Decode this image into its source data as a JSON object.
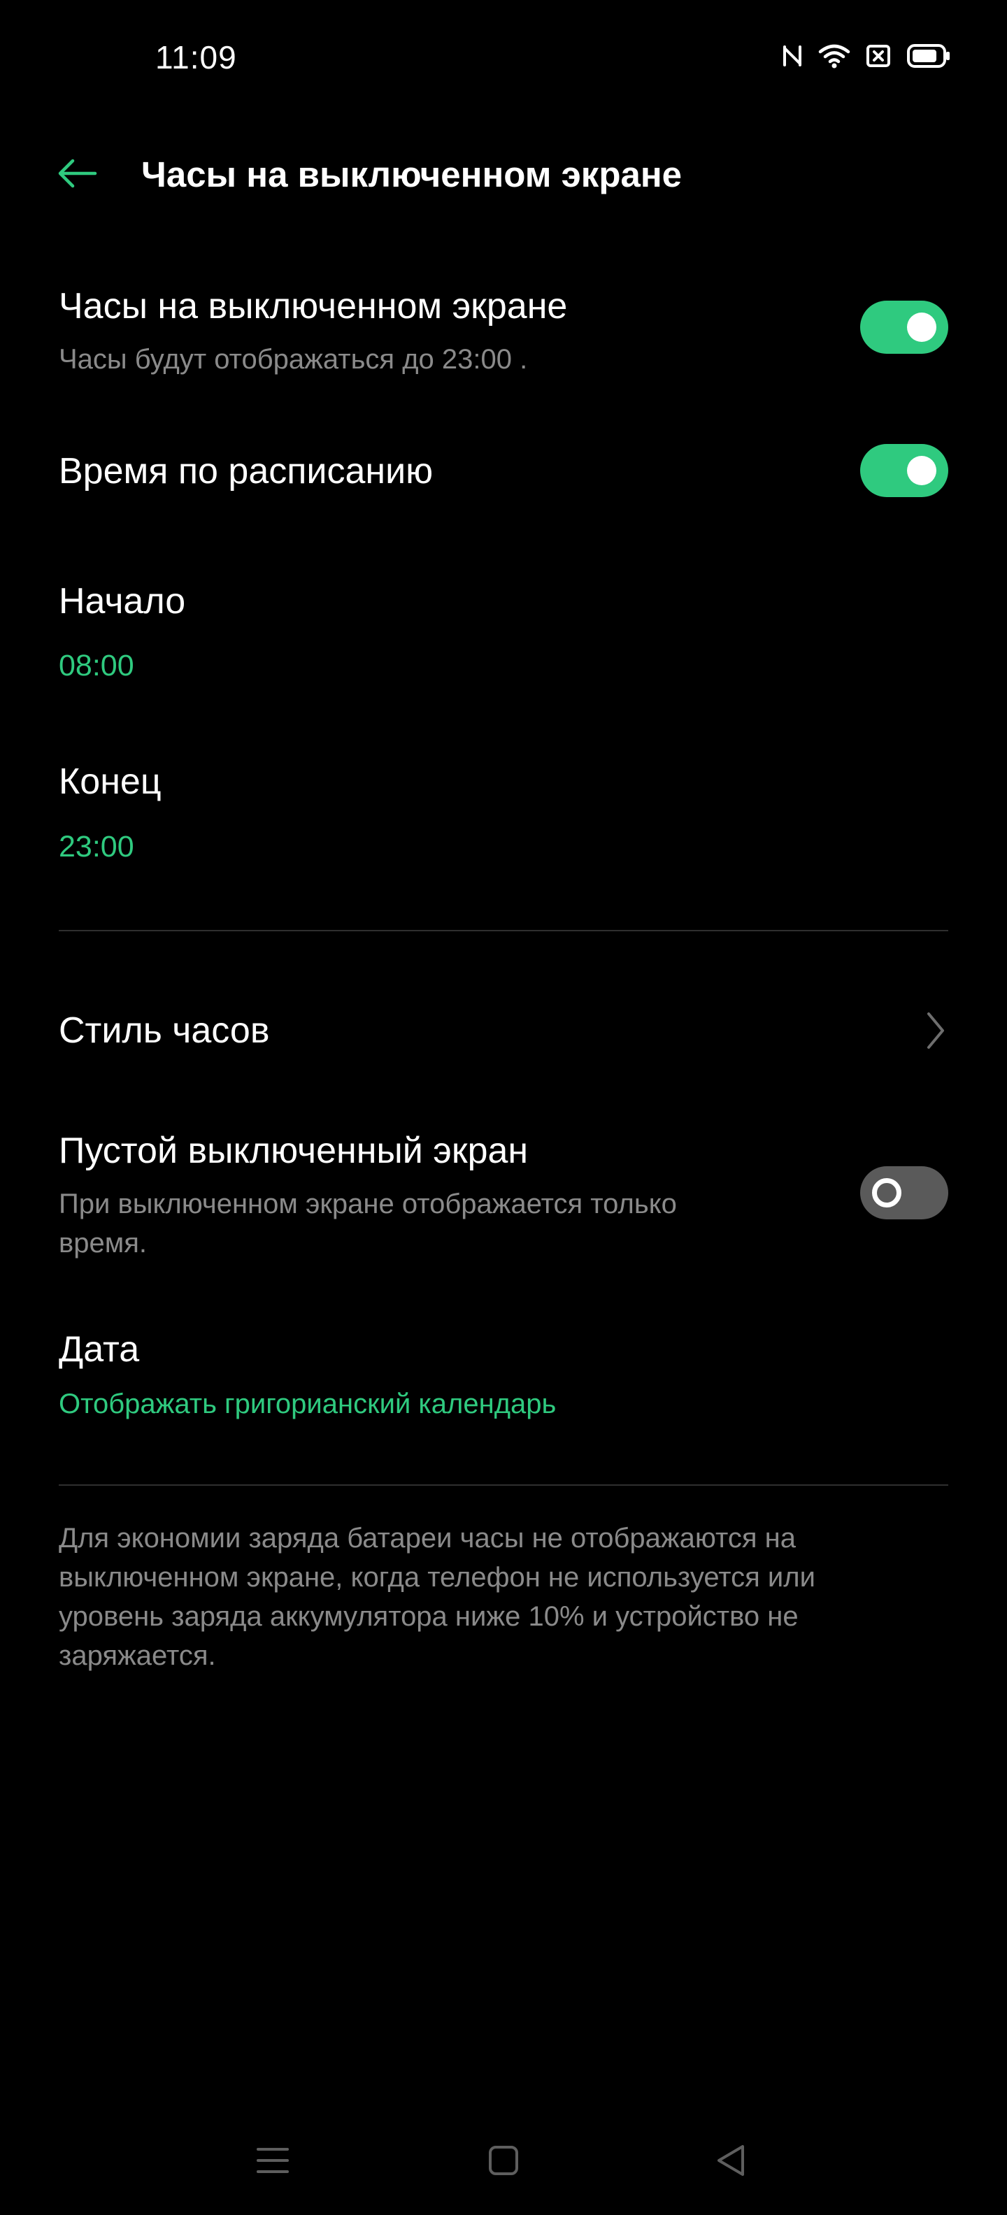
{
  "status_bar": {
    "time": "11:09",
    "icons": [
      "nfc-icon",
      "wifi-icon",
      "sim-no-signal-icon",
      "battery-icon"
    ]
  },
  "header": {
    "back_icon": "arrow-left-icon",
    "title": "Часы на выключенном экране"
  },
  "settings": {
    "aod": {
      "title": "Часы на выключенном экране",
      "subtitle": "Часы будут отображаться до  23:00 .",
      "enabled": true
    },
    "schedule": {
      "title": "Время по расписанию",
      "enabled": true
    },
    "start": {
      "title": "Начало",
      "value": "08:00"
    },
    "end": {
      "title": "Конец",
      "value": "23:00"
    },
    "clock_style": {
      "title": "Стиль часов",
      "icon": "chevron-right-icon"
    },
    "blank_screen": {
      "title": "Пустой выключенный экран",
      "subtitle_line1": "При выключенном экране отображается только",
      "subtitle_line2": "время.",
      "enabled": false
    },
    "date": {
      "title": "Дата",
      "value": "Отображать григорианский календарь"
    }
  },
  "footer_note": "Для экономии заряда батареи часы не отображаются на выключенном экране, когда телефон не используется или уровень заряда аккумулятора ниже 10% и устройство не заряжается.",
  "nav_bar": {
    "icons": [
      "menu-icon",
      "home-icon",
      "back-icon"
    ]
  },
  "colors": {
    "background": "#000000",
    "accent": "#2fca7f",
    "secondary_text": "#8a8a8a",
    "switch_off": "#5a5a5a"
  }
}
